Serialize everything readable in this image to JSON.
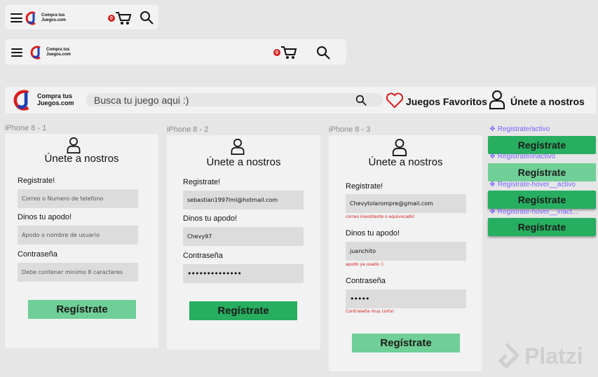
{
  "brand": {
    "logo_letters": "CJ",
    "name": "Compra tus\nJuegos.com",
    "red": "#d81e1e",
    "blue": "#1e3fb5"
  },
  "header_small": {
    "cart_count": "0"
  },
  "header_medium": {
    "cart_count": "0"
  },
  "header_desktop": {
    "search_placeholder": "Busca tu juego aqui :)",
    "favorites_label": "Juegos Favoritos",
    "join_label": "Únete a nostros"
  },
  "frames": [
    {
      "label": "iPhone 8 - 1",
      "title": "Únete a nostros",
      "fields": [
        {
          "label": "Registrate!",
          "value": "",
          "placeholder": "Correo o Numero de telefono",
          "error": ""
        },
        {
          "label": "Dinos tu apodo!",
          "value": "",
          "placeholder": "Apodo o nombre de usuario",
          "error": ""
        },
        {
          "label": "Contraseña",
          "value": "",
          "placeholder": "Debe contener minimo 8 caracteres",
          "error": ""
        }
      ],
      "button": "Regístrate"
    },
    {
      "label": "iPhone 8 - 2",
      "title": "Únete a nostros",
      "fields": [
        {
          "label": "Registrate!",
          "value": "sebastian1997lml@hotmail.com",
          "error": ""
        },
        {
          "label": "Dinos tu apodo!",
          "value": "Chevy97",
          "error": ""
        },
        {
          "label": "Contraseña",
          "value": "••••••••••••••",
          "error": ""
        }
      ],
      "button": "Regístrate"
    },
    {
      "label": "iPhone 8 - 3",
      "title": "Únete a nostros",
      "fields": [
        {
          "label": "Registrate!",
          "value": "Chevytolarompre@gmail.com",
          "error": "correo inexistente o equivocado!"
        },
        {
          "label": "Dinos tu apodo!",
          "value": "juanchito",
          "error": "apodo ya usado :("
        },
        {
          "label": "Contraseña",
          "value": "•••••",
          "error": "Contraseña muy corta!"
        }
      ],
      "button": "Regístrate"
    }
  ],
  "variants": [
    {
      "label": "❖ Registrate/activo",
      "button": "Regístrate",
      "state": "active"
    },
    {
      "label": "❖ Registrate/inactivo",
      "button": "Regístrate",
      "state": "inactive"
    },
    {
      "label": "❖ Registrate-hover__activo",
      "button": "Regístrate",
      "state": "active"
    },
    {
      "label": "❖ Registrate-hover__inact...",
      "button": "Regístrate",
      "state": "active"
    }
  ],
  "watermark": "Platzi",
  "colors": {
    "button_active": "#27ae60",
    "button_inactive": "#6fcf97",
    "error": "#d01818",
    "variant_label": "#7b61ff"
  }
}
